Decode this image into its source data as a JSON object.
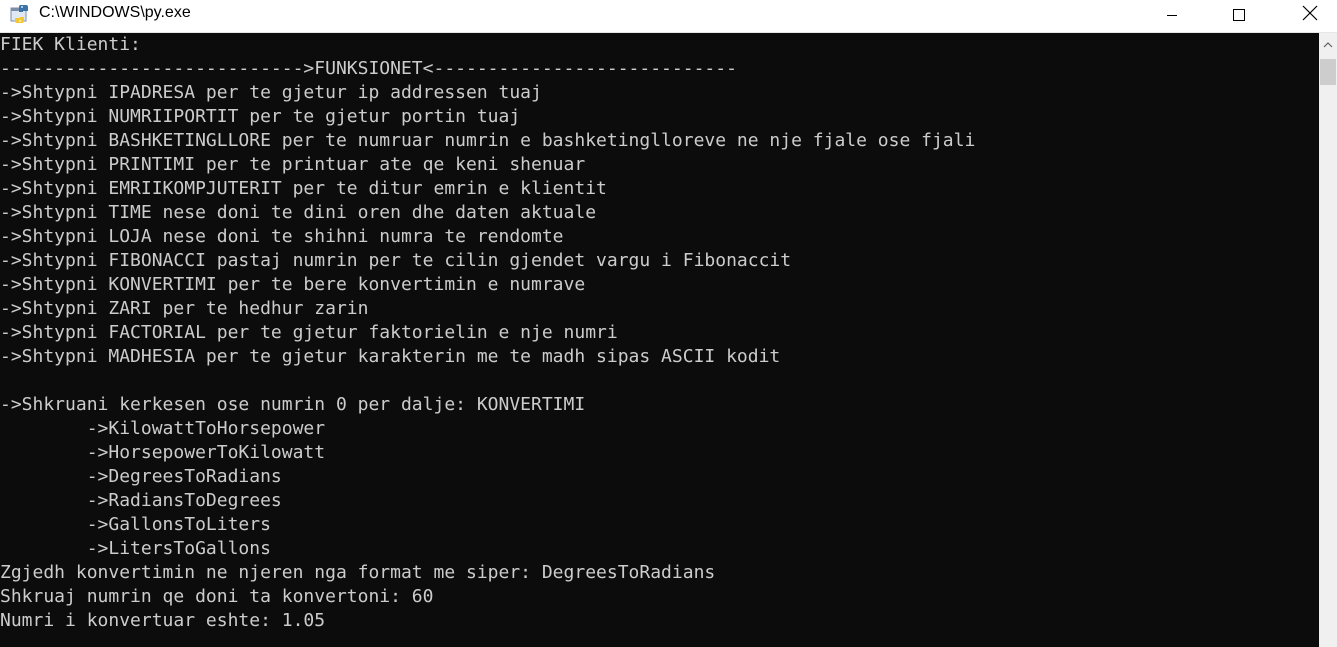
{
  "window": {
    "title": "C:\\WINDOWS\\py.exe",
    "icon": "python-launcher-icon",
    "controls": [
      "minimize-icon",
      "maximize-icon",
      "close-icon"
    ]
  },
  "console": {
    "lines": [
      "FIEK Klienti:",
      "---------------------------->FUNKSIONET<----------------------------",
      "->Shtypni IPADRESA per te gjetur ip addressen tuaj",
      "->Shtypni NUMRIIPORTIT per te gjetur portin tuaj",
      "->Shtypni BASHKETINGLLORE per te numruar numrin e bashketinglloreve ne nje fjale ose fjali",
      "->Shtypni PRINTIMI per te printuar ate qe keni shenuar",
      "->Shtypni EMRIIKOMPJUTERIT per te ditur emrin e klientit",
      "->Shtypni TIME nese doni te dini oren dhe daten aktuale",
      "->Shtypni LOJA nese doni te shihni numra te rendomte",
      "->Shtypni FIBONACCI pastaj numrin per te cilin gjendet vargu i Fibonaccit",
      "->Shtypni KONVERTIMI per te bere konvertimin e numrave",
      "->Shtypni ZARI per te hedhur zarin",
      "->Shtypni FACTORIAL per te gjetur faktorielin e nje numri",
      "->Shtypni MADHESIA per te gjetur karakterin me te madh sipas ASCII kodit",
      "",
      "->Shkruani kerkesen ose numrin 0 per dalje: KONVERTIMI",
      "        ->KilowattToHorsepower",
      "        ->HorsepowerToKilowatt",
      "        ->DegreesToRadians",
      "        ->RadiansToDegrees",
      "        ->GallonsToLiters",
      "        ->LitersToGallons",
      "Zgjedh konvertimin ne njeren nga format me siper: DegreesToRadians",
      "Shkruaj numrin qe doni ta konvertoni: 60",
      "Numri i konvertuar eshte: 1.05"
    ]
  },
  "colors": {
    "console_bg": "#0c0c0c",
    "console_fg": "#cccccc",
    "titlebar_bg": "#ffffff",
    "scrollbar_bg": "#f0f0f0",
    "scroll_thumb": "#cdcdcd"
  }
}
